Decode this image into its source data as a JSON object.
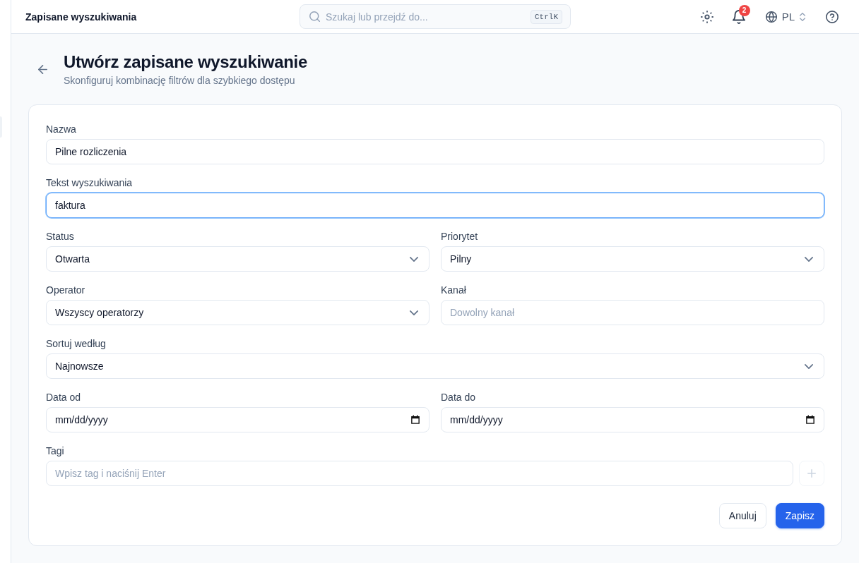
{
  "header": {
    "title": "Zapisane wyszukiwania",
    "search": {
      "placeholder": "Szukaj lub przejdź do...",
      "shortcut": "CtrlK"
    },
    "notifications": {
      "count": "2"
    },
    "language": "PL"
  },
  "page": {
    "title": "Utwórz zapisane wyszukiwanie",
    "subtitle": "Skonfiguruj kombinację filtrów dla szybkiego dostępu"
  },
  "form": {
    "rows": [
      {
        "fields": [
          {
            "label": "Nazwa",
            "kind": "text",
            "value": "Pilne rozliczenia",
            "focused": false
          }
        ]
      },
      {
        "fields": [
          {
            "label": "Tekst wyszukiwania",
            "kind": "text",
            "value": "faktura",
            "focused": true
          }
        ]
      },
      {
        "fields": [
          {
            "label": "Status",
            "kind": "select",
            "value": "Otwarta",
            "focused": false
          },
          {
            "label": "Priorytet",
            "kind": "select",
            "value": "Pilny",
            "focused": false
          }
        ]
      },
      {
        "fields": [
          {
            "label": "Operator",
            "kind": "select",
            "value": "Wszyscy operatorzy",
            "focused": false
          },
          {
            "label": "Kanał",
            "kind": "text",
            "placeholder": "Dowolny kanał",
            "focused": false
          }
        ]
      },
      {
        "fields": [
          {
            "label": "Sortuj według",
            "kind": "select",
            "value": "Najnowsze",
            "focused": false
          }
        ]
      },
      {
        "fields": [
          {
            "label": "Data od",
            "kind": "date",
            "placeholder": "mm/dd/yyyy",
            "focused": false
          },
          {
            "label": "Data do",
            "kind": "date",
            "placeholder": "mm/dd/yyyy",
            "focused": false
          }
        ]
      },
      {
        "fields": [
          {
            "label": "Tagi",
            "kind": "tags",
            "placeholder": "Wpisz tag i naciśnij Enter",
            "focused": false,
            "add_button": {
              "disabled": true
            }
          }
        ]
      }
    ]
  },
  "actions": [
    {
      "label": "Anuluj",
      "kind": "secondary"
    },
    {
      "label": "Zapisz",
      "kind": "primary"
    }
  ]
}
